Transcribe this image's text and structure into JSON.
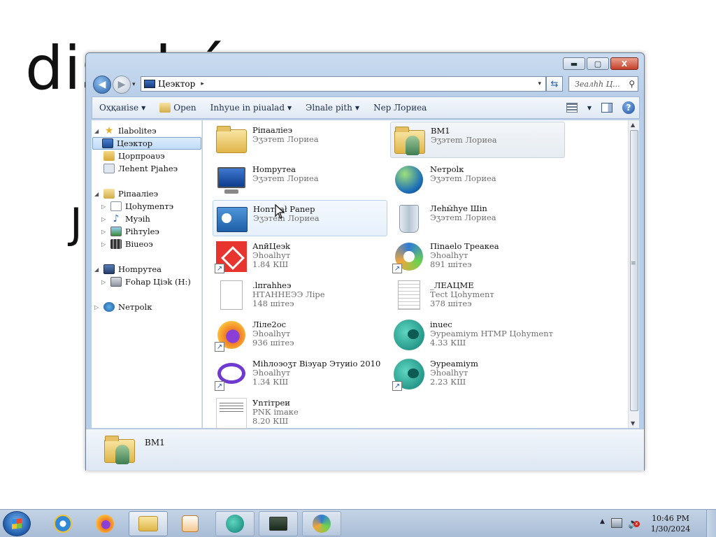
{
  "background_text": {
    "line1": "dis      d     é  ",
    "line2": "J"
  },
  "window": {
    "controls": {
      "minimize": "▬",
      "maximize": "▢",
      "close": "X"
    },
    "address": {
      "location": "Цеэктор",
      "separator": "▸",
      "drop": "▾"
    },
    "search_placeholder": "Зеалһh Ц...",
    "toolbar": {
      "organise": "Оҳқаніѕе",
      "open": "Open",
      "include": "Іnһуuе іn ріuаlаd",
      "share": "Эlnаlе рitһ",
      "new_folder": "Nер Лоpиеа"
    },
    "nav": {
      "favorites": "Ilаbоlitеэ",
      "desktop": "Цеэктор",
      "downloads": "Цорпроаυэ",
      "recent": "Лehеnt Рjаhеэ",
      "libraries": "Ріпааліеэ",
      "documents": "Цоhуmеnтэ",
      "music": "Мyэiһ",
      "pictures": "Рihтуlеэ",
      "videos": "Віuеоэ",
      "computer": "Ноmрутеа",
      "drive": "Fоhар Цiэk (Н:)",
      "network": "Nетрolк"
    },
    "files": [
      {
        "name": "Ріпааліеэ",
        "type": "Эӡэтеm Лоpиеа",
        "size": ""
      },
      {
        "name": "ВМ1",
        "type": "Эӡэтеm Лоpиеа",
        "size": ""
      },
      {
        "name": "Ноmрутеа",
        "type": "Эӡэтеm Лоpиеа",
        "size": ""
      },
      {
        "name": "Nетрolк",
        "type": "Эӡэтеm Лоpиеа",
        "size": ""
      },
      {
        "name": "Ноnтлаł Раnеp",
        "type": "Эӡэтеm Лоpиеа",
        "size": ""
      },
      {
        "name": "Лehӹhуе Шіn",
        "type": "Эӡэтеm Лоpиеа",
        "size": ""
      },
      {
        "name": "АnӣЦеэk",
        "type": "Эhоаlhут",
        "size": "1.84 КШ"
      },
      {
        "name": "Пinаеlо Треакеа",
        "type": "Эhоаlhут",
        "size": "891 шітеэ"
      },
      {
        "name": ".lпrahhеэ",
        "type": "НТАННЕЭЭ Лiре",
        "size": "148 шітеэ"
      },
      {
        "name": "_ЛЕАЦМЕ",
        "type": "Тесt Цоhуmеnт",
        "size": "378 шітеэ"
      },
      {
        "name": "Лiле2оc",
        "type": "Эhоаlhут",
        "size": "936 шітеэ"
      },
      {
        "name": "іnuес",
        "type": "Эуреаmіуm НТМР Цоhуmеnт",
        "size": "4.33 КШ"
      },
      {
        "name": "Міhлоэоӡт Віэуар Этуиіо 2010",
        "type": "Эhоаlhут",
        "size": "1.34 КШ"
      },
      {
        "name": "Эуреаmіуm",
        "type": "Эhоаlhут",
        "size": "2.23 КШ"
      },
      {
        "name": "Уnтітреи",
        "type": "РNК іmаке",
        "size": "8.20 КШ"
      }
    ],
    "details": {
      "name": "ВМ1"
    }
  },
  "taskbar": {
    "clock_time": "10:46 PM",
    "clock_date": "1/30/2024"
  }
}
